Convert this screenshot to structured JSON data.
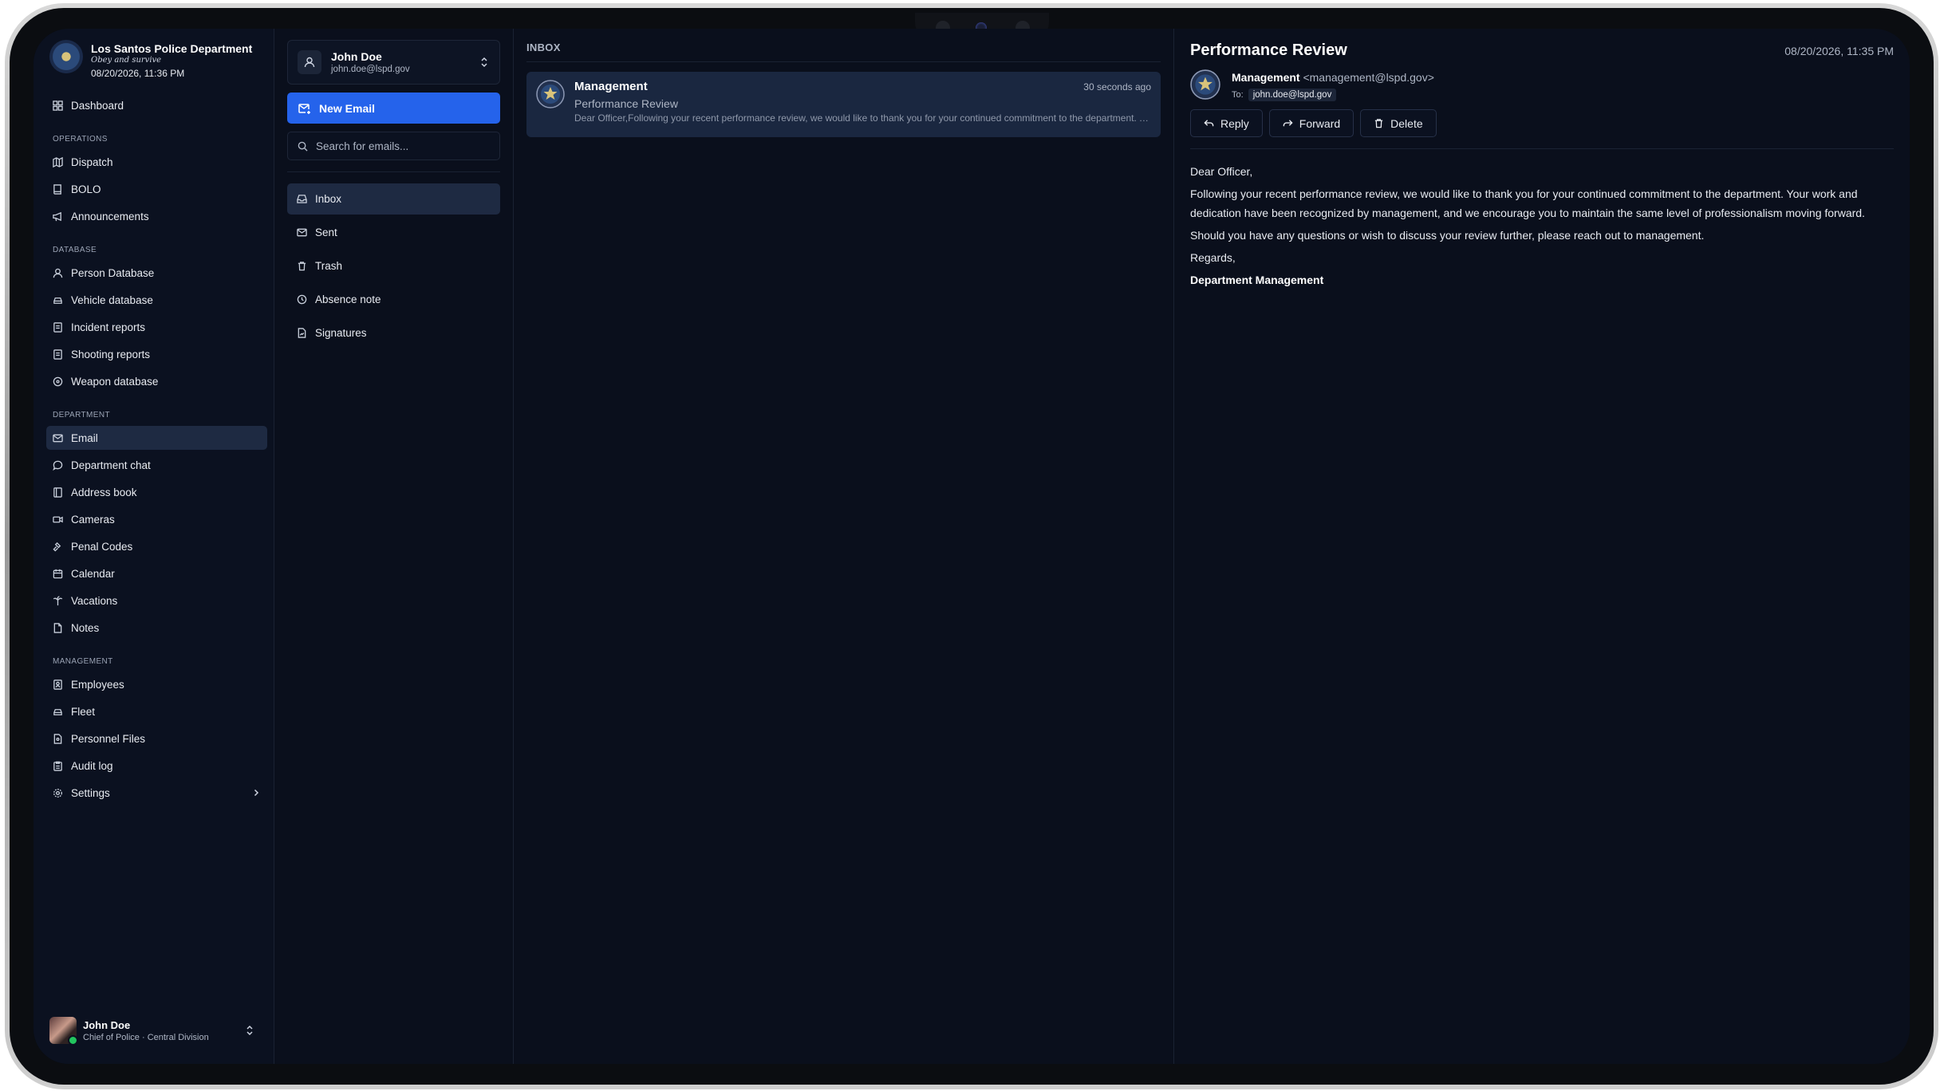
{
  "brand": {
    "name": "Los Santos Police Department",
    "motto": "Obey and survive",
    "datetime": "08/20/2026, 11:36 PM"
  },
  "sidebar": {
    "dashboard": "Dashboard",
    "sections": [
      {
        "label": "OPERATIONS",
        "items": [
          "Dispatch",
          "BOLO",
          "Announcements"
        ]
      },
      {
        "label": "DATABASE",
        "items": [
          "Person Database",
          "Vehicle database",
          "Incident reports",
          "Shooting reports",
          "Weapon database"
        ]
      },
      {
        "label": "DEPARTMENT",
        "items": [
          "Email",
          "Department chat",
          "Address book",
          "Cameras",
          "Penal Codes",
          "Calendar",
          "Vacations",
          "Notes"
        ]
      },
      {
        "label": "MANAGEMENT",
        "items": [
          "Employees",
          "Fleet",
          "Personnel Files",
          "Audit log",
          "Settings"
        ]
      }
    ],
    "active_item": "Email",
    "user": {
      "name": "John Doe",
      "role": "Chief of Police · Central Division"
    }
  },
  "mail": {
    "account": {
      "name": "John Doe",
      "email": "john.doe@lspd.gov"
    },
    "new_email_label": "New Email",
    "search_placeholder": "Search for emails...",
    "folders": [
      "Inbox",
      "Sent",
      "Trash",
      "Absence note",
      "Signatures"
    ],
    "active_folder": "Inbox"
  },
  "inbox": {
    "header": "INBOX",
    "messages": [
      {
        "from": "Management",
        "time": "30 seconds ago",
        "subject": "Performance Review",
        "preview": "Dear Officer,Following your recent performance review, we would like to thank you for your continued commitment to the department. Your work and dedication have been recognized"
      }
    ]
  },
  "reader": {
    "title": "Performance Review",
    "date": "08/20/2026, 11:35 PM",
    "sender_name": "Management",
    "sender_email": "<management@lspd.gov>",
    "to_label": "To:",
    "to": "john.doe@lspd.gov",
    "actions": {
      "reply": "Reply",
      "forward": "Forward",
      "delete": "Delete"
    },
    "body": {
      "greeting": "Dear Officer,",
      "p1": "Following your recent performance review, we would like to thank you for your continued commitment to the department. Your work and dedication have been recognized by management, and we encourage you to maintain the same level of professionalism moving forward.",
      "p2": "Should you have any questions or wish to discuss your review further, please reach out to management.",
      "closing": "Regards,",
      "signature": "Department Management"
    }
  },
  "colors": {
    "background": "#0a0f1c",
    "accent": "#2563eb",
    "active_item": "#1e2a42",
    "message_card": "#1a2740"
  }
}
